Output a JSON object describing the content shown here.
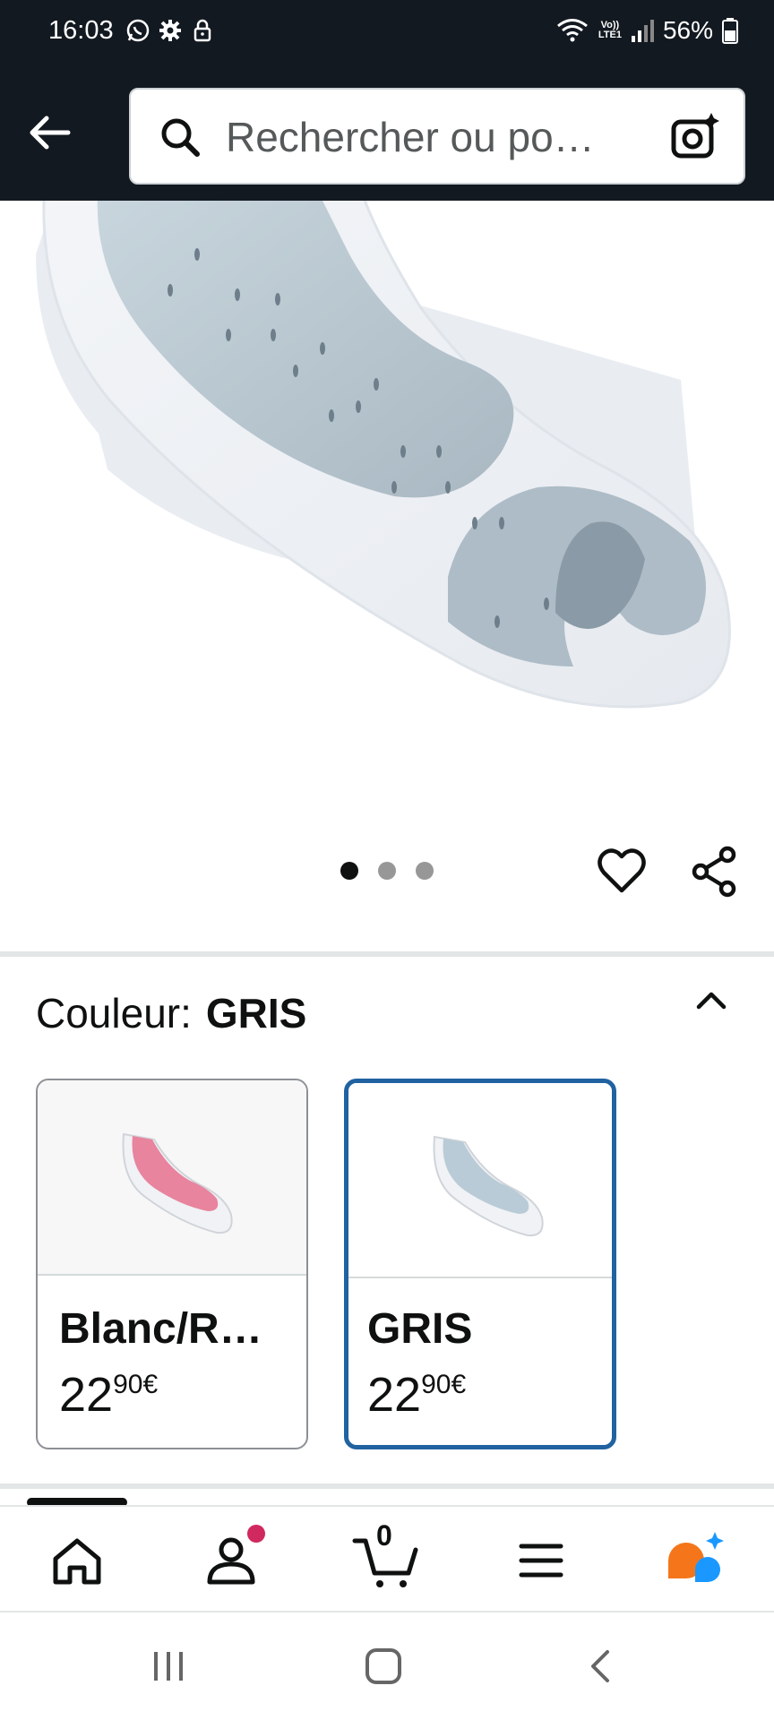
{
  "status_bar": {
    "time": "16:03",
    "lte_top": "Vo))",
    "lte_bottom": "LTE1",
    "battery": "56%"
  },
  "search": {
    "placeholder": "Rechercher ou po…"
  },
  "carousel": {
    "active_index": 0,
    "count": 3
  },
  "color_section": {
    "label": "Couleur:",
    "selected": "GRIS"
  },
  "swatches": [
    {
      "name": "Blanc/R…",
      "price_whole": "22",
      "price_cents": "90",
      "currency": "€",
      "color": "#e8849e",
      "selected": false
    },
    {
      "name": "GRIS",
      "price_whole": "22",
      "price_cents": "90",
      "currency": "€",
      "color": "#b9cbd6",
      "selected": true
    }
  ],
  "bottom_nav": {
    "items": [
      "home-icon",
      "account-icon",
      "cart-icon",
      "menu-icon",
      "rufus-icon"
    ],
    "cart_count": "0"
  },
  "colors": {
    "header_bg": "#131921",
    "selected_border": "#2162a1",
    "badge": "#d0295f",
    "rufus_orange": "#f5761a",
    "rufus_blue": "#1a98ff"
  }
}
